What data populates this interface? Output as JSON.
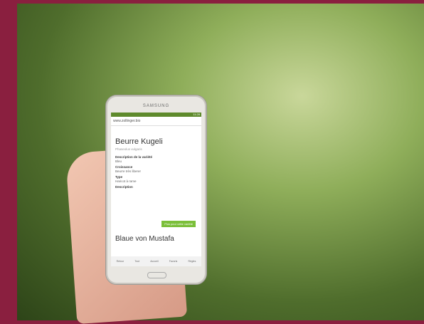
{
  "phone": {
    "brand": "SAMSUNG",
    "time": "11:28",
    "url": "www.zollinger.bio",
    "title": "Beurre Kugeli",
    "subtitle": "Phaseolus vulgaris",
    "desc_label": "Description de la variété",
    "desc_value": "Bleu",
    "growth_label": "Croissance",
    "growth_value": "Beurre très liberer",
    "type_label": "Type",
    "type_value": "Haricot à rame",
    "description_label": "Description",
    "button_label": "Plus pour cette variété",
    "next_item": "Blaue von Mustafa",
    "nav": [
      "Retour",
      "Tout",
      "Accueil",
      "Favoris",
      "Règles"
    ]
  }
}
